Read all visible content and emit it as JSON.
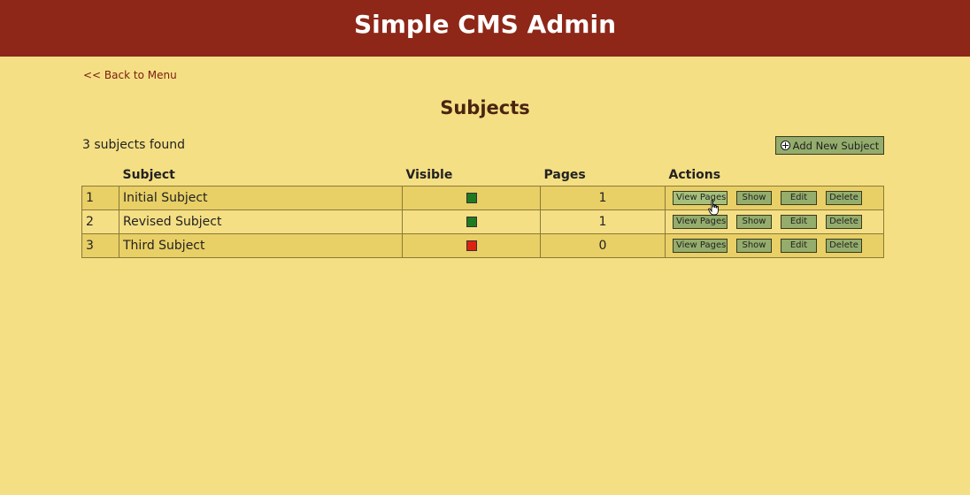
{
  "header": {
    "title": "Simple CMS Admin"
  },
  "nav": {
    "back_label": "<< Back to Menu"
  },
  "page": {
    "title": "Subjects",
    "count_text": "3 subjects found",
    "add_button_label": "Add New Subject"
  },
  "table": {
    "columns": [
      "",
      "Subject",
      "Visible",
      "Pages",
      "Actions"
    ],
    "rows": [
      {
        "id": "1",
        "subject": "Initial Subject",
        "visible": true,
        "visible_color": "#1f7a22",
        "pages": "1"
      },
      {
        "id": "2",
        "subject": "Revised Subject",
        "visible": true,
        "visible_color": "#1f7a22",
        "pages": "1"
      },
      {
        "id": "3",
        "subject": "Third Subject",
        "visible": false,
        "visible_color": "#dd2214",
        "pages": "0"
      }
    ],
    "actions": {
      "view_pages": "View Pages",
      "show": "Show",
      "edit": "Edit",
      "delete": "Delete"
    }
  },
  "colors": {
    "header_bg": "#8e2718",
    "page_bg": "#f5df84",
    "button_bg": "#94ad6c"
  }
}
